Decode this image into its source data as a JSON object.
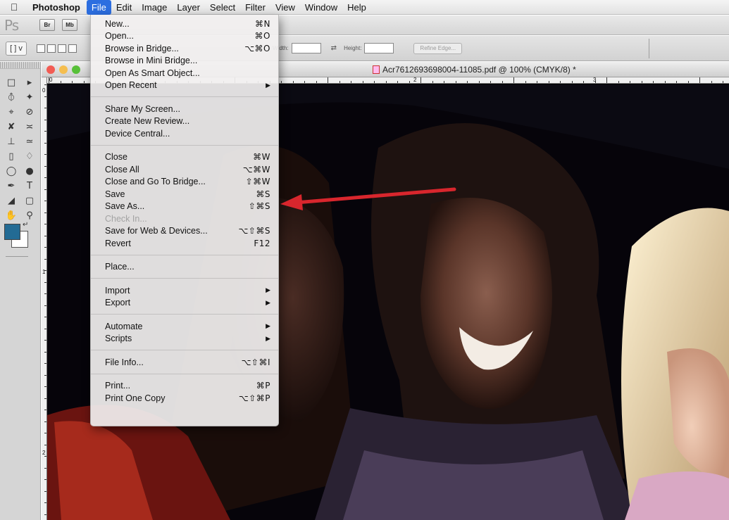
{
  "menubar": {
    "app_name": "Photoshop",
    "items": [
      "File",
      "Edit",
      "Image",
      "Layer",
      "Select",
      "Filter",
      "View",
      "Window",
      "Help"
    ]
  },
  "appbar": {
    "logo": "Ps",
    "bridge_label": "Br",
    "minibridge_label": "Mb"
  },
  "options": {
    "marquee_button": "[ ] v",
    "width_label": "Width:",
    "height_label": "Height:",
    "refine_edge": "Refine Edge..."
  },
  "document": {
    "title": "Acr7612693698004-11085.pdf @ 100% (CMYK/8) *",
    "ruler_top_labels": [
      "0",
      "2",
      "3"
    ],
    "ruler_left_labels": [
      "0",
      "1",
      "2"
    ],
    "foreground_color": "#236b94",
    "background_color": "#ffffff"
  },
  "file_menu": {
    "groups": [
      [
        {
          "label": "New...",
          "shortcut": "⌘N"
        },
        {
          "label": "Open...",
          "shortcut": "⌘O"
        },
        {
          "label": "Browse in Bridge...",
          "shortcut": "⌥⌘O"
        },
        {
          "label": "Browse in Mini Bridge...",
          "shortcut": ""
        },
        {
          "label": "Open As Smart Object...",
          "shortcut": ""
        },
        {
          "label": "Open Recent",
          "shortcut": "",
          "submenu": true
        }
      ],
      [
        {
          "label": "Share My Screen...",
          "shortcut": ""
        },
        {
          "label": "Create New Review...",
          "shortcut": ""
        },
        {
          "label": "Device Central...",
          "shortcut": ""
        }
      ],
      [
        {
          "label": "Close",
          "shortcut": "⌘W"
        },
        {
          "label": "Close All",
          "shortcut": "⌥⌘W"
        },
        {
          "label": "Close and Go To Bridge...",
          "shortcut": "⇧⌘W"
        },
        {
          "label": "Save",
          "shortcut": "⌘S"
        },
        {
          "label": "Save As...",
          "shortcut": "⇧⌘S"
        },
        {
          "label": "Check In...",
          "shortcut": "",
          "disabled": true
        },
        {
          "label": "Save for Web & Devices...",
          "shortcut": "⌥⇧⌘S"
        },
        {
          "label": "Revert",
          "shortcut": "F12"
        }
      ],
      [
        {
          "label": "Place...",
          "shortcut": ""
        }
      ],
      [
        {
          "label": "Import",
          "shortcut": "",
          "submenu": true
        },
        {
          "label": "Export",
          "shortcut": "",
          "submenu": true
        }
      ],
      [
        {
          "label": "Automate",
          "shortcut": "",
          "submenu": true
        },
        {
          "label": "Scripts",
          "shortcut": "",
          "submenu": true
        }
      ],
      [
        {
          "label": "File Info...",
          "shortcut": "⌥⇧⌘I"
        }
      ],
      [
        {
          "label": "Print...",
          "shortcut": "⌘P"
        },
        {
          "label": "Print One Copy",
          "shortcut": "⌥⇧⌘P"
        }
      ]
    ]
  },
  "annotation": {
    "arrow_color": "#d8262d",
    "points_to": "Save"
  }
}
